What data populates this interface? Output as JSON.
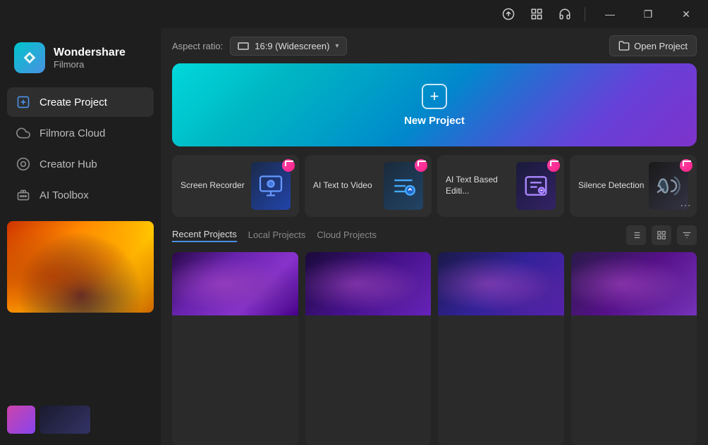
{
  "app": {
    "name": "Wondershare",
    "sub": "Filmora"
  },
  "titlebar": {
    "icons": [
      "upload-icon",
      "grid-icon",
      "headset-icon"
    ],
    "buttons": [
      "minimize-button",
      "maximize-button",
      "close-button"
    ],
    "min_label": "—",
    "max_label": "❐",
    "close_label": "✕"
  },
  "sidebar": {
    "items": [
      {
        "id": "create-project",
        "label": "Create Project",
        "icon": "➕",
        "active": true
      },
      {
        "id": "filmora-cloud",
        "label": "Filmora Cloud",
        "icon": "☁"
      },
      {
        "id": "creator-hub",
        "label": "Creator Hub",
        "icon": "◎"
      },
      {
        "id": "ai-toolbox",
        "label": "AI Toolbox",
        "icon": "🤖"
      }
    ]
  },
  "toolbar": {
    "aspect_ratio_label": "Aspect ratio:",
    "aspect_ratio_value": "16:9 (Widescreen)",
    "open_project_label": "Open Project"
  },
  "new_project": {
    "label": "New Project"
  },
  "feature_cards": [
    {
      "id": "screen-recorder",
      "label": "Screen Recorder",
      "icon": "📹"
    },
    {
      "id": "text-to-video",
      "label": "AI Text to Video",
      "icon": "T"
    },
    {
      "id": "text-based-editing",
      "label": "AI Text Based Editi...",
      "icon": "[…]"
    },
    {
      "id": "silence-detection",
      "label": "Silence Detection",
      "icon": "🎧"
    }
  ],
  "recent": {
    "tabs": [
      {
        "label": "Recent Projects",
        "active": true
      },
      {
        "label": "Local Projects"
      },
      {
        "label": "Cloud Projects"
      }
    ],
    "actions": [
      "list-view",
      "grid-view",
      "settings"
    ],
    "items": [
      {
        "id": 1,
        "thumb_class": "recent-thumb-1"
      },
      {
        "id": 2,
        "thumb_class": "recent-thumb-2"
      },
      {
        "id": 3,
        "thumb_class": "recent-thumb-3"
      },
      {
        "id": 4,
        "thumb_class": "recent-thumb-4"
      }
    ]
  }
}
